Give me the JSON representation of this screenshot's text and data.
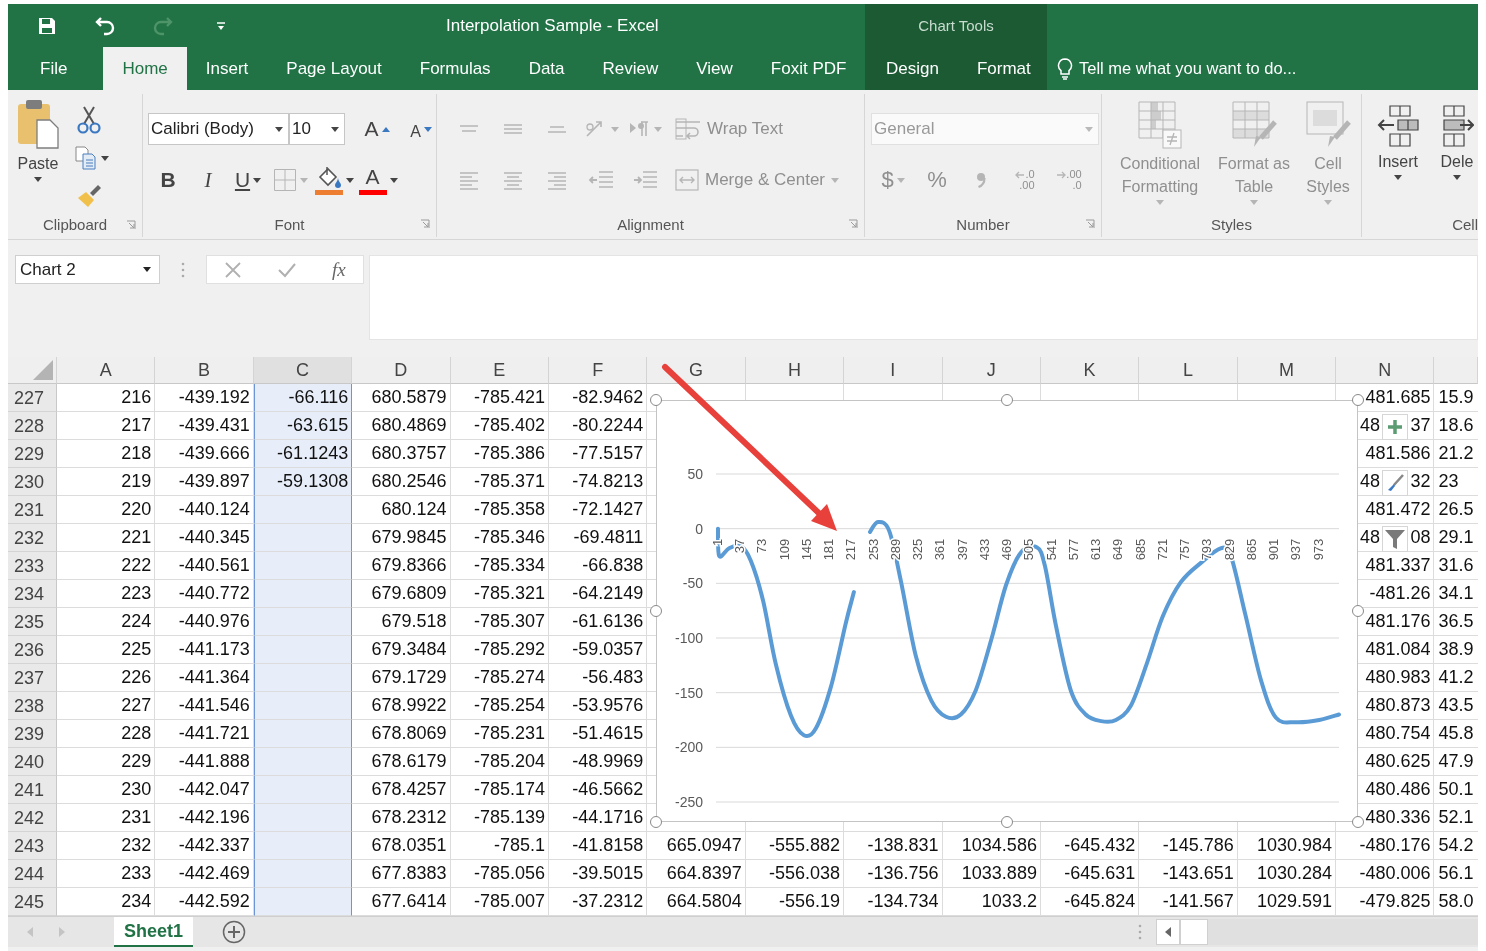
{
  "quick_access": [
    {
      "kind": "save",
      "disabled": false
    },
    {
      "kind": "undo",
      "disabled": false
    },
    {
      "kind": "redo",
      "disabled": true
    },
    {
      "kind": "customize",
      "disabled": false
    }
  ],
  "window": {
    "title": "Interpolation Sample - Excel"
  },
  "contextual": {
    "title": "Chart Tools"
  },
  "tabs": [
    {
      "label": "File",
      "selected": false
    },
    {
      "label": "Home",
      "selected": true
    },
    {
      "label": "Insert",
      "selected": false
    },
    {
      "label": "Page Layout",
      "selected": false
    },
    {
      "label": "Formulas",
      "selected": false
    },
    {
      "label": "Data",
      "selected": false
    },
    {
      "label": "Review",
      "selected": false
    },
    {
      "label": "View",
      "selected": false
    },
    {
      "label": "Foxit PDF",
      "selected": false
    },
    {
      "label": "Design",
      "selected": false,
      "contextual": true
    },
    {
      "label": "Format",
      "selected": false,
      "contextual": true
    }
  ],
  "tell_me": {
    "placeholder": "Tell me what you want to do..."
  },
  "ribbon": {
    "groups": [
      {
        "label": "Clipboard",
        "launcher": true,
        "large": [
          {
            "kind": "paste",
            "label": "Paste",
            "dropdown": true,
            "disabled": false
          }
        ],
        "lines": [
          [
            {
              "kind": "cut",
              "disabled": false
            }
          ],
          [
            {
              "kind": "copy",
              "dropdown": true,
              "disabled": false
            }
          ],
          [
            {
              "kind": "format-painter",
              "disabled": false
            }
          ]
        ]
      },
      {
        "label": "Font",
        "launcher": true,
        "lines": [
          [
            {
              "kind": "font-field",
              "value": "Calibri (Body)",
              "dropdown": true,
              "disabled": false
            },
            {
              "kind": "size-field",
              "value": "10",
              "dropdown": true,
              "disabled": false
            },
            {
              "kind": "grow-font",
              "label": "A",
              "disabled": false
            },
            {
              "kind": "shrink-font",
              "label": "A",
              "disabled": false
            }
          ],
          [
            {
              "kind": "bold",
              "label": "B",
              "disabled": false
            },
            {
              "kind": "italic",
              "label": "I",
              "disabled": false
            },
            {
              "kind": "underline",
              "label": "U",
              "dropdown": true,
              "disabled": false
            },
            {
              "kind": "borders",
              "dropdown": true,
              "disabled": true
            },
            {
              "kind": "fill-color",
              "dropdown": true,
              "color": "#ed7d31",
              "disabled": false
            },
            {
              "kind": "font-color",
              "label": "A",
              "dropdown": true,
              "color": "#ff0000",
              "disabled": false
            }
          ]
        ]
      },
      {
        "label": "Alignment",
        "launcher": true,
        "lines": [
          [
            {
              "kind": "align-top",
              "disabled": true
            },
            {
              "kind": "align-middle",
              "disabled": true
            },
            {
              "kind": "align-bottom",
              "disabled": true
            },
            {
              "kind": "orientation",
              "dropdown": true,
              "disabled": true
            },
            {
              "kind": "text-direction",
              "dropdown": true,
              "disabled": true
            },
            {
              "kind": "wrap-text",
              "label": "Wrap Text",
              "disabled": true
            }
          ],
          [
            {
              "kind": "align-left",
              "disabled": true
            },
            {
              "kind": "align-center",
              "disabled": true
            },
            {
              "kind": "align-right",
              "disabled": true
            },
            {
              "kind": "decrease-indent",
              "disabled": true
            },
            {
              "kind": "increase-indent",
              "disabled": true
            },
            {
              "kind": "merge",
              "label": "Merge & Center",
              "dropdown": true,
              "disabled": true
            }
          ]
        ]
      },
      {
        "label": "Number",
        "launcher": true,
        "lines": [
          [
            {
              "kind": "number-format-field",
              "value": "General",
              "dropdown": true,
              "disabled": true
            }
          ],
          [
            {
              "kind": "currency",
              "label": "$",
              "dropdown": true,
              "disabled": true
            },
            {
              "kind": "percent",
              "label": "%",
              "disabled": true
            },
            {
              "kind": "comma",
              "disabled": true
            },
            {
              "kind": "increase-decimal",
              "top": ".0",
              "bottom": ".00",
              "disabled": true
            },
            {
              "kind": "decrease-decimal",
              "top": ".00",
              "bottom": ".0",
              "disabled": true
            }
          ]
        ]
      },
      {
        "label": "Styles",
        "large": [
          {
            "kind": "conditional-formatting",
            "label": "Conditional Formatting",
            "dropdown": true,
            "disabled": true
          },
          {
            "kind": "format-as-table",
            "label": "Format as Table",
            "dropdown": true,
            "disabled": true
          },
          {
            "kind": "cell-styles",
            "label": "Cell Styles",
            "dropdown": true,
            "disabled": true
          }
        ]
      },
      {
        "label": "Cell",
        "large": [
          {
            "kind": "insert-cells",
            "label": "Insert",
            "dropdown": true,
            "disabled": false
          },
          {
            "kind": "delete-cells",
            "label": "Dele",
            "dropdown": true,
            "disabled": false
          }
        ]
      }
    ]
  },
  "formula_bar": {
    "name_box": "Chart 2",
    "function_label": "fx"
  },
  "columns": [
    {
      "label": "A",
      "selected": false
    },
    {
      "label": "B",
      "selected": false
    },
    {
      "label": "C",
      "selected": true
    },
    {
      "label": "D",
      "selected": false
    },
    {
      "label": "E",
      "selected": false
    },
    {
      "label": "F",
      "selected": false
    },
    {
      "label": "G",
      "selected": false
    },
    {
      "label": "H",
      "selected": false
    },
    {
      "label": "I",
      "selected": false
    },
    {
      "label": "J",
      "selected": false
    },
    {
      "label": "K",
      "selected": false
    },
    {
      "label": "L",
      "selected": false
    },
    {
      "label": "M",
      "selected": false
    },
    {
      "label": "N",
      "selected": false
    },
    {
      "selected": false
    }
  ],
  "rows": [
    {
      "number": "227",
      "cells": [
        "216",
        "-439.192",
        "-66.116",
        "680.5879",
        "-785.421",
        "-82.9462",
        null,
        null,
        null,
        null,
        null,
        null,
        null,
        "481.685",
        "15.9"
      ]
    },
    {
      "number": "228",
      "cells": [
        "217",
        "-439.431",
        "-63.615",
        "680.4869",
        "-785.402",
        "-80.2244",
        null,
        null,
        null,
        null,
        null,
        null,
        null,
        [
          "48",
          "37"
        ],
        "18.6"
      ]
    },
    {
      "number": "229",
      "cells": [
        "218",
        "-439.666",
        "-61.1243",
        "680.3757",
        "-785.386",
        "-77.5157",
        null,
        null,
        null,
        null,
        null,
        null,
        null,
        "481.586",
        "21.2"
      ]
    },
    {
      "number": "230",
      "cells": [
        "219",
        "-439.897",
        "-59.1308",
        "680.2546",
        "-785.371",
        "-74.8213",
        null,
        null,
        null,
        null,
        null,
        null,
        null,
        [
          "48",
          "32"
        ],
        "23"
      ]
    },
    {
      "number": "231",
      "cells": [
        "220",
        "-440.124",
        null,
        "680.124",
        "-785.358",
        "-72.1427",
        null,
        null,
        null,
        null,
        null,
        null,
        null,
        "481.472",
        "26.5"
      ]
    },
    {
      "number": "232",
      "cells": [
        "221",
        "-440.345",
        null,
        "679.9845",
        "-785.346",
        "-69.4811",
        null,
        null,
        null,
        null,
        null,
        null,
        null,
        [
          "48",
          "08"
        ],
        "29.1"
      ]
    },
    {
      "number": "233",
      "cells": [
        "222",
        "-440.561",
        null,
        "679.8366",
        "-785.334",
        "-66.838",
        null,
        null,
        null,
        null,
        null,
        null,
        null,
        "481.337",
        "31.6"
      ]
    },
    {
      "number": "234",
      "cells": [
        "223",
        "-440.772",
        null,
        "679.6809",
        "-785.321",
        "-64.2149",
        null,
        null,
        null,
        null,
        null,
        null,
        null,
        "-481.26",
        "34.1"
      ]
    },
    {
      "number": "235",
      "cells": [
        "224",
        "-440.976",
        null,
        "679.518",
        "-785.307",
        "-61.6136",
        null,
        null,
        null,
        null,
        null,
        null,
        null,
        "481.176",
        "36.5"
      ]
    },
    {
      "number": "236",
      "cells": [
        "225",
        "-441.173",
        null,
        "679.3484",
        "-785.292",
        "-59.0357",
        null,
        null,
        null,
        null,
        null,
        null,
        null,
        "481.084",
        "38.9"
      ]
    },
    {
      "number": "237",
      "cells": [
        "226",
        "-441.364",
        null,
        "679.1729",
        "-785.274",
        "-56.483",
        null,
        null,
        null,
        null,
        null,
        null,
        null,
        "480.983",
        "41.2"
      ]
    },
    {
      "number": "238",
      "cells": [
        "227",
        "-441.546",
        null,
        "678.9922",
        "-785.254",
        "-53.9576",
        null,
        null,
        null,
        null,
        null,
        null,
        null,
        "480.873",
        "43.5"
      ]
    },
    {
      "number": "239",
      "cells": [
        "228",
        "-441.721",
        null,
        "678.8069",
        "-785.231",
        "-51.4615",
        null,
        null,
        null,
        null,
        null,
        null,
        null,
        "480.754",
        "45.8"
      ]
    },
    {
      "number": "240",
      "cells": [
        "229",
        "-441.888",
        null,
        "678.6179",
        "-785.204",
        "-48.9969",
        null,
        null,
        null,
        null,
        null,
        null,
        null,
        "480.625",
        "47.9"
      ]
    },
    {
      "number": "241",
      "cells": [
        "230",
        "-442.047",
        null,
        "678.4257",
        "-785.174",
        "-46.5662",
        null,
        null,
        null,
        null,
        null,
        null,
        null,
        "480.486",
        "50.1"
      ]
    },
    {
      "number": "242",
      "cells": [
        "231",
        "-442.196",
        null,
        "678.2312",
        "-785.139",
        "-44.1716",
        null,
        null,
        null,
        null,
        null,
        null,
        null,
        "480.336",
        "52.1"
      ]
    },
    {
      "number": "243",
      "cells": [
        "232",
        "-442.337",
        null,
        "678.0351",
        "-785.1",
        "-41.8158",
        "665.0947",
        "-555.882",
        "-138.831",
        "1034.586",
        "-645.432",
        "-145.786",
        "1030.984",
        "-480.176",
        "54.2"
      ]
    },
    {
      "number": "244",
      "cells": [
        "233",
        "-442.469",
        null,
        "677.8383",
        "-785.056",
        "-39.5015",
        "664.8397",
        "-556.038",
        "-136.756",
        "1033.889",
        "-645.631",
        "-143.651",
        "1030.284",
        "-480.006",
        "56.1"
      ]
    },
    {
      "number": "245",
      "cells": [
        "234",
        "-442.592",
        null,
        "677.6414",
        "-785.007",
        "-37.2312",
        "664.5804",
        "-556.19",
        "-134.734",
        "1033.2",
        "-645.824",
        "-141.567",
        "1029.591",
        "-479.825",
        "58.0"
      ]
    }
  ],
  "chart": {
    "selected": true,
    "chart_data": {
      "type": "line",
      "grid": true,
      "xlim": [
        1,
        1006
      ],
      "ylim": [
        -250,
        50
      ],
      "xticks": [
        1,
        37,
        73,
        109,
        145,
        181,
        217,
        253,
        289,
        325,
        361,
        397,
        433,
        469,
        505,
        541,
        577,
        613,
        649,
        685,
        721,
        757,
        793,
        829,
        865,
        901,
        937,
        973
      ],
      "yticks": [
        -250,
        -200,
        -150,
        -100,
        -50,
        0,
        50
      ],
      "x": [
        1,
        3,
        19,
        38,
        54,
        74,
        95,
        119,
        140,
        160,
        184,
        208,
        221,
        247,
        260,
        278,
        297,
        321,
        346,
        370,
        394,
        418,
        443,
        467,
        491,
        517,
        530,
        548,
        572,
        596,
        621,
        645,
        669,
        694,
        721,
        750,
        783,
        815,
        831,
        855,
        880,
        904,
        936,
        974,
        1006
      ],
      "series": [
        {
          "color": "#5b9bd5",
          "values": [
            0,
            -25,
            -18,
            -16,
            -29,
            -66,
            -125,
            -171,
            -189,
            -182,
            -144,
            -86,
            -58,
            null,
            null,
            null,
            null,
            null,
            null,
            null,
            null,
            null,
            null,
            null,
            null,
            null,
            null,
            null,
            null,
            null,
            null,
            null,
            null,
            null,
            null,
            null,
            null,
            null,
            null,
            null,
            null,
            null,
            null,
            null,
            null
          ]
        },
        {
          "color": "#5b9bd5",
          "values": [
            null,
            null,
            null,
            null,
            null,
            null,
            null,
            null,
            null,
            null,
            null,
            null,
            null,
            -3,
            6,
            -2,
            -48,
            -116,
            -157,
            -172,
            -170,
            -148,
            -102,
            -52,
            -22,
            -17,
            -34,
            -89,
            -148,
            -170,
            -176,
            -175,
            -162,
            -125,
            -80,
            -49,
            -31,
            -18,
            -25,
            -80,
            -139,
            -173,
            -177,
            -175,
            -170
          ]
        }
      ]
    }
  },
  "annotation": {
    "kind": "arrow",
    "color": "#e8403a"
  },
  "sheets": [
    {
      "label": "Sheet1",
      "selected": true
    }
  ]
}
